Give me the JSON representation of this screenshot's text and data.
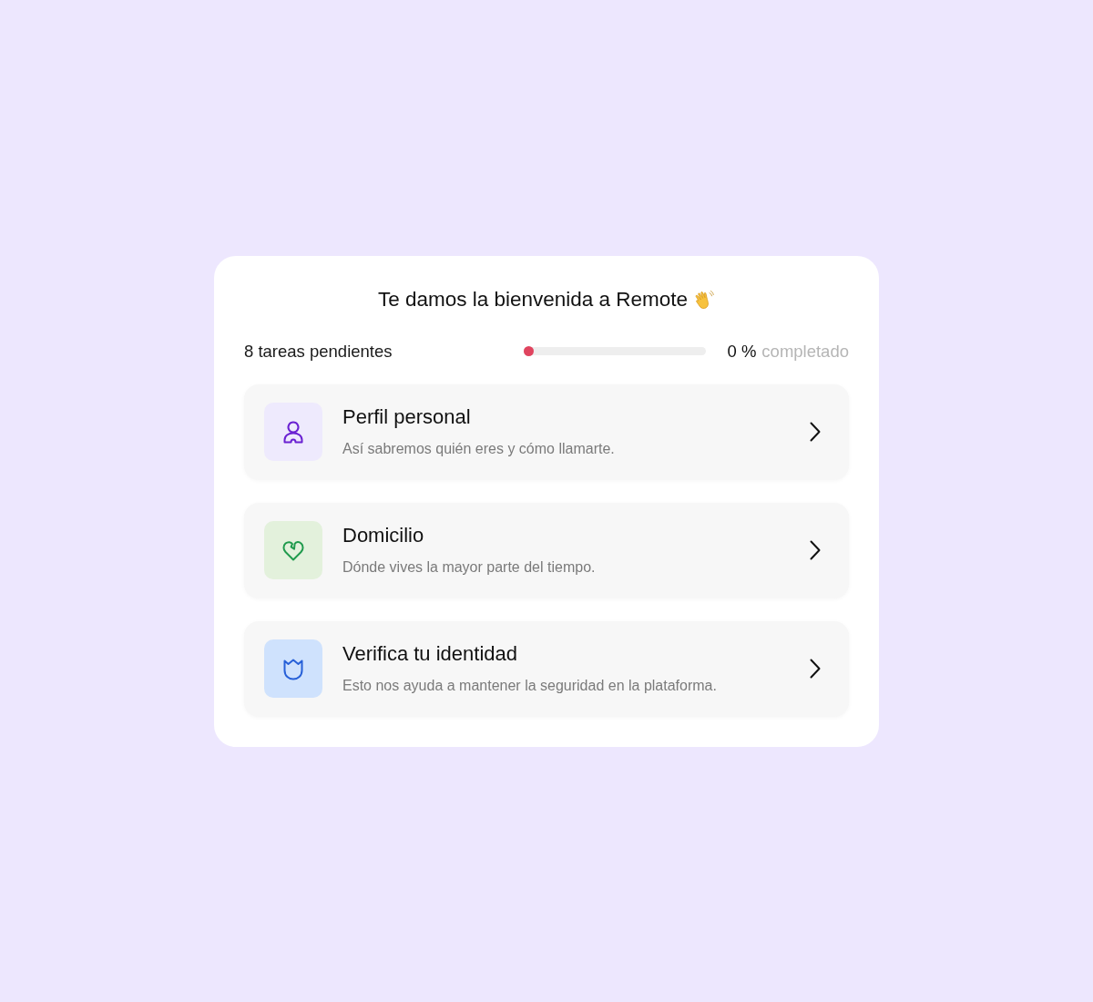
{
  "header": {
    "title": "Te damos la bienvenida a Remote"
  },
  "progress": {
    "pending_label": "8 tareas pendientes",
    "level": 0,
    "percent": "0 %",
    "suffix": "completado"
  },
  "tasks": [
    {
      "kind": "person",
      "title": "Perfil personal",
      "description": "Así sabremos quién eres y cómo llamarte."
    },
    {
      "kind": "heart",
      "title": "Domicilio",
      "description": "Dónde vives la mayor parte del tiempo."
    },
    {
      "kind": "shield",
      "title": "Verifica tu identidad",
      "description": "Esto nos ayuda a mantener la seguridad en la plataforma."
    }
  ]
}
